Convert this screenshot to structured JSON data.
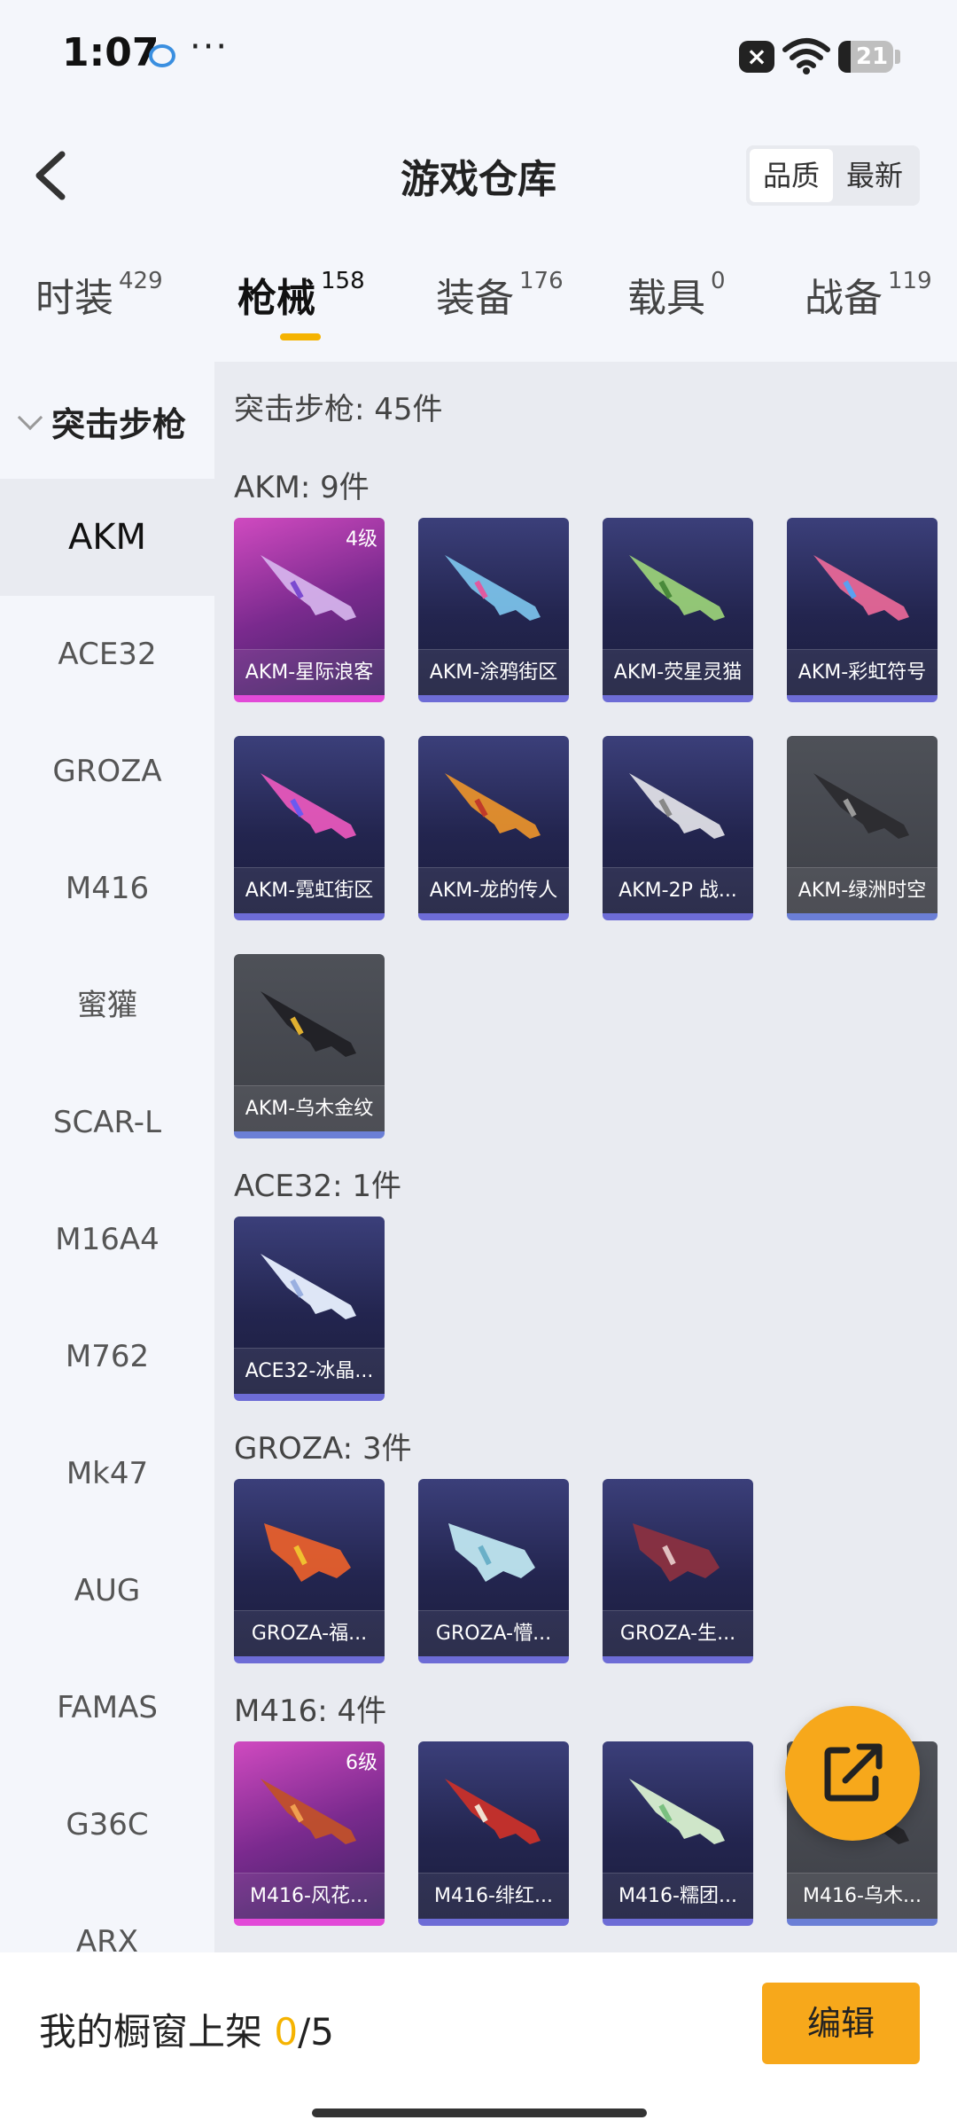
{
  "status_bar": {
    "time": "1:07",
    "dots": "···",
    "battery": "21"
  },
  "header": {
    "title": "游戏仓库",
    "sort_quality": "品质",
    "sort_latest": "最新"
  },
  "tabs": [
    {
      "name": "时装",
      "count": "429"
    },
    {
      "name": "枪械",
      "count": "158"
    },
    {
      "name": "装备",
      "count": "176"
    },
    {
      "name": "载具",
      "count": "0"
    },
    {
      "name": "战备",
      "count": "119"
    }
  ],
  "sidebar": {
    "heading": "突击步枪",
    "items": [
      "AKM",
      "ACE32",
      "GROZA",
      "M416",
      "蜜獾",
      "SCAR-L",
      "M16A4",
      "M762",
      "Mk47",
      "AUG",
      "FAMAS",
      "G36C",
      "ARX"
    ]
  },
  "content": {
    "category_total": "突击步枪: 45件",
    "groups": [
      {
        "title": "AKM: 9件",
        "items": [
          {
            "label": "AKM-星际浪客",
            "level": "4级"
          },
          {
            "label": "AKM-涂鸦街区"
          },
          {
            "label": "AKM-荧星灵猫"
          },
          {
            "label": "AKM-彩虹符号"
          },
          {
            "label": "AKM-霓虹街区"
          },
          {
            "label": "AKM-龙的传人"
          },
          {
            "label": "AKM-2P 战..."
          },
          {
            "label": "AKM-绿洲时空"
          },
          {
            "label": "AKM-乌木金纹"
          }
        ]
      },
      {
        "title": "ACE32: 1件",
        "items": [
          {
            "label": "ACE32-冰晶..."
          }
        ]
      },
      {
        "title": "GROZA: 3件",
        "items": [
          {
            "label": "GROZA-福..."
          },
          {
            "label": "GROZA-懵..."
          },
          {
            "label": "GROZA-生..."
          }
        ]
      },
      {
        "title": "M416: 4件",
        "items": [
          {
            "label": "M416-风花...",
            "level": "6级"
          },
          {
            "label": "M416-绯红..."
          },
          {
            "label": "M416-糯团..."
          },
          {
            "label": "M416-乌木..."
          }
        ]
      }
    ]
  },
  "bottom": {
    "label": "我的橱窗上架 ",
    "current": "0",
    "total": "/5",
    "edit_button": "编辑"
  },
  "colors": {
    "accent": "#f7a81b",
    "underline": "#f5b301",
    "card_purple": "#23254f",
    "card_pink": "#d04ac0"
  }
}
